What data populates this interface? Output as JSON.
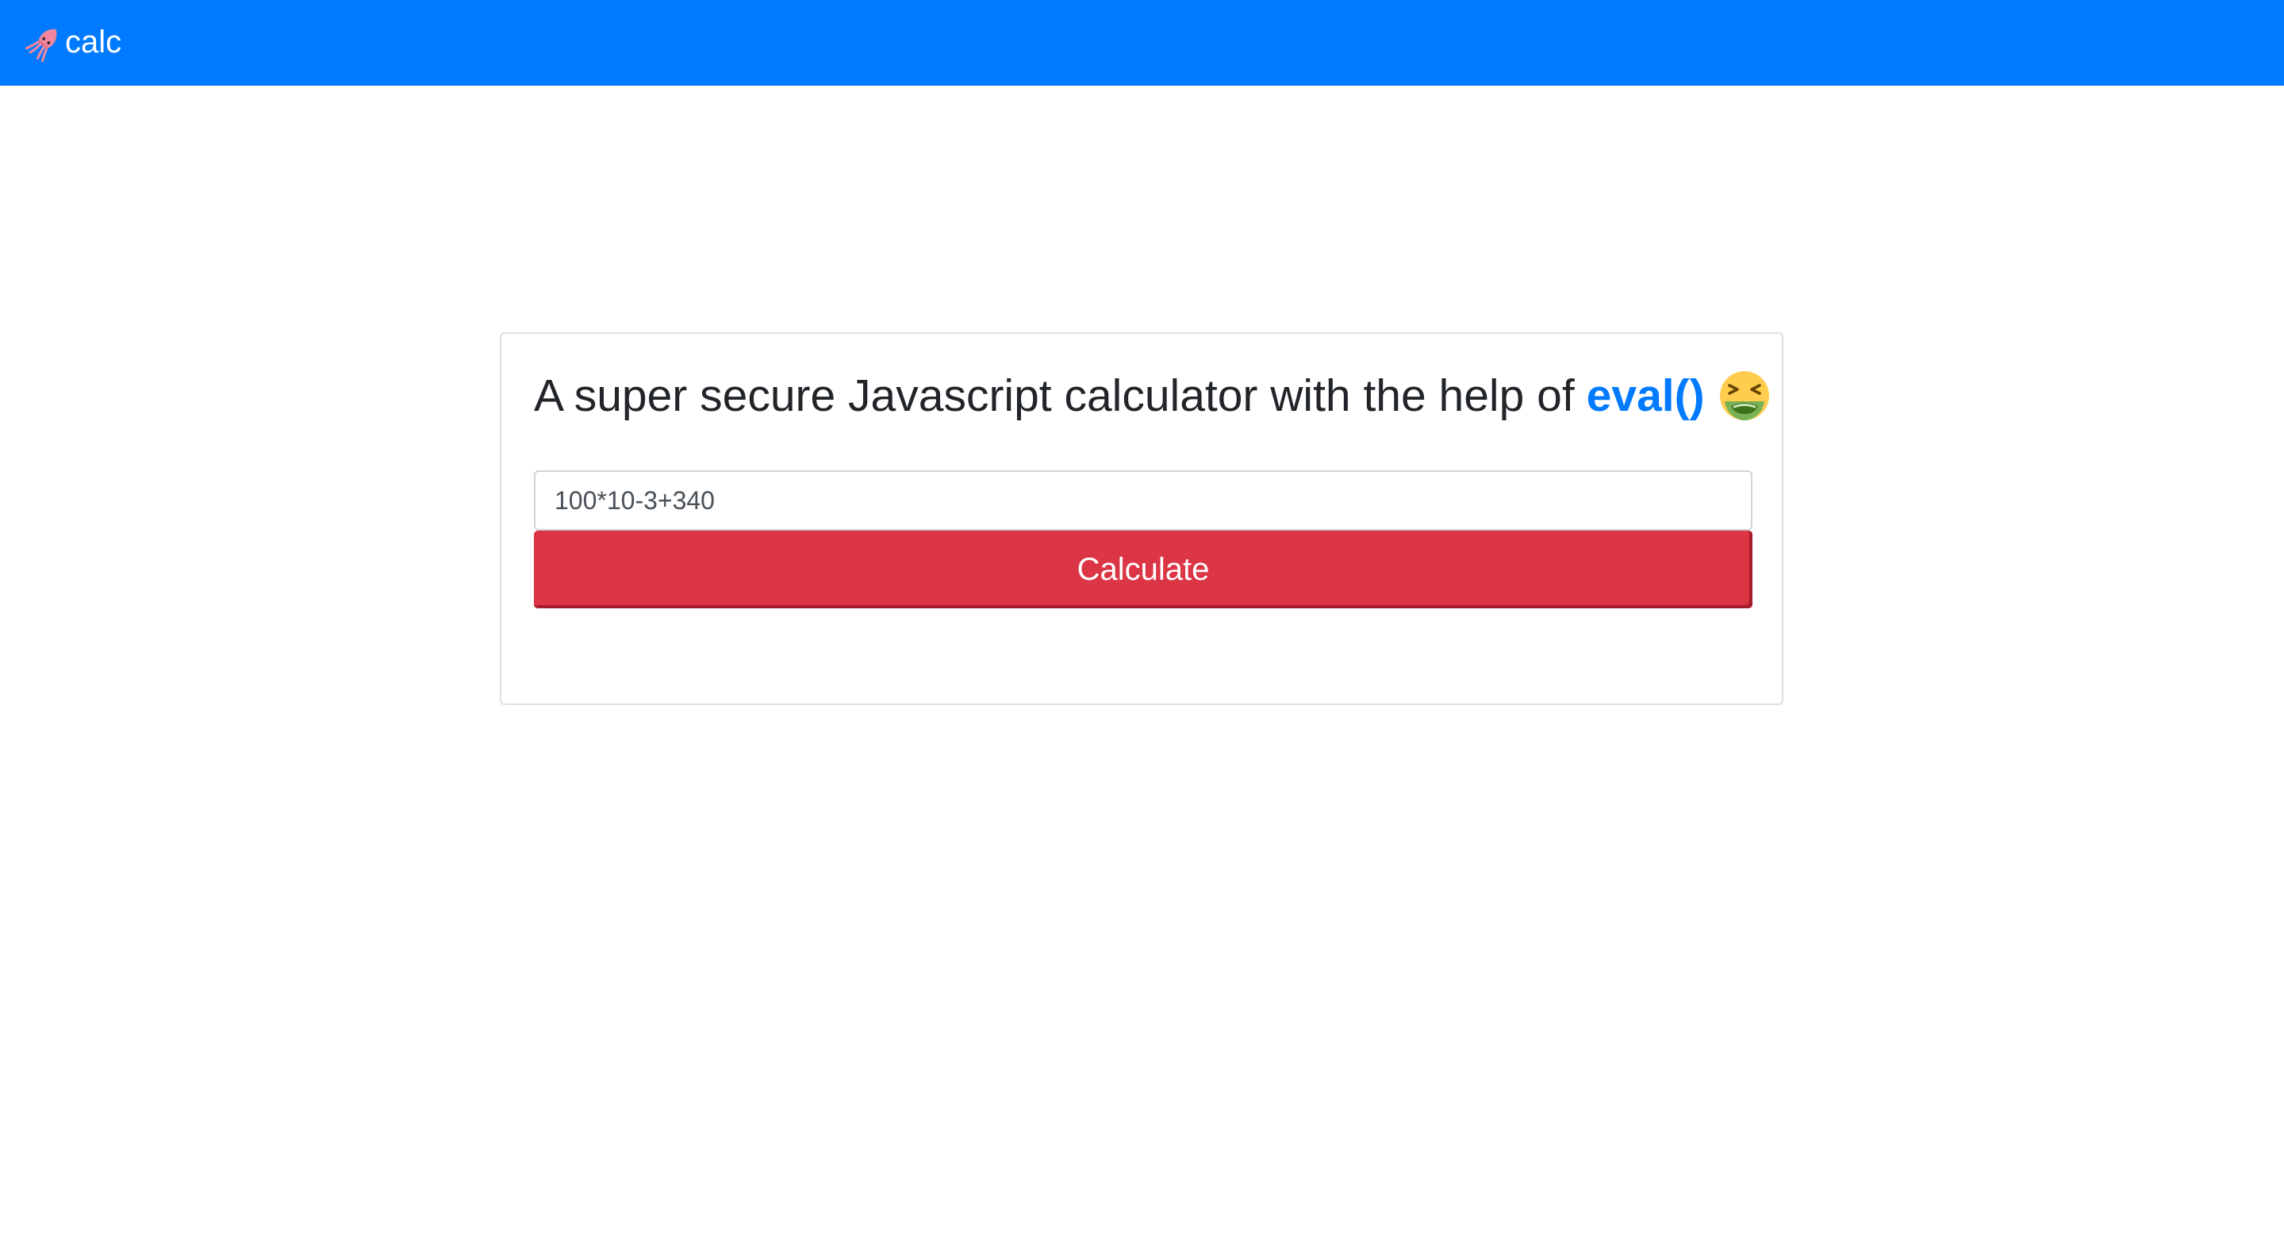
{
  "navbar": {
    "brand_text": "calc",
    "brand_icon": "squid-icon",
    "background_color": "#007bff"
  },
  "card": {
    "title_prefix": "A super secure Javascript calculator with the help of",
    "title_highlight": "eval()",
    "title_emoji_icon": "nauseated-face-icon",
    "highlight_color": "#007bff"
  },
  "form": {
    "expression_value": "100*10-3+340",
    "button_label": "Calculate",
    "button_color": "#dc3545"
  }
}
